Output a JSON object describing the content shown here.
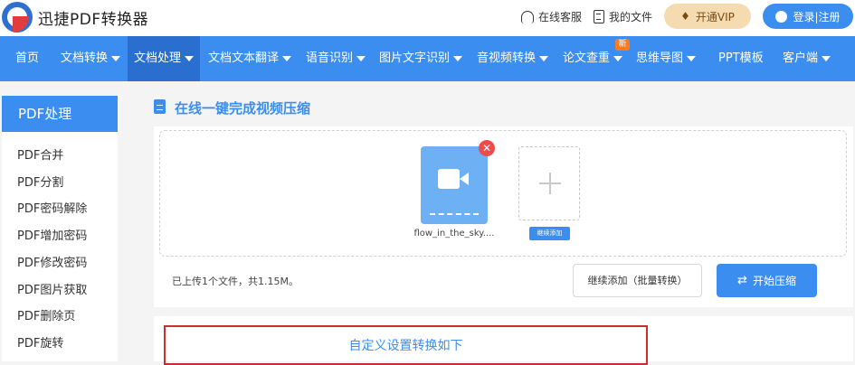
{
  "header": {
    "brand": "迅捷PDF转换器",
    "online_service": "在线客服",
    "my_files": "我的文件",
    "vip": "开通VIP",
    "login": "登录|注册"
  },
  "nav": {
    "items": [
      {
        "label": "首页",
        "has_caret": false
      },
      {
        "label": "文档转换",
        "has_caret": true
      },
      {
        "label": "文档处理",
        "has_caret": true,
        "active": true
      },
      {
        "label": "文档文本翻译",
        "has_caret": true
      },
      {
        "label": "语音识别",
        "has_caret": true
      },
      {
        "label": "图片文字识别",
        "has_caret": true
      },
      {
        "label": "音视频转换",
        "has_caret": true
      },
      {
        "label": "论文查重",
        "has_caret": true
      },
      {
        "label": "思维导图",
        "has_caret": true
      },
      {
        "label": "PPT模板",
        "has_caret": false
      },
      {
        "label": "客户端",
        "has_caret": true
      }
    ],
    "new_badge": "新"
  },
  "sidebar": {
    "heading": "PDF处理",
    "items": [
      "PDF合并",
      "PDF分割",
      "PDF密码解除",
      "PDF增加密码",
      "PDF修改密码",
      "PDF图片获取",
      "PDF删除页",
      "PDF旋转"
    ]
  },
  "main": {
    "section_title": "在线一键完成视频压缩",
    "file": {
      "name": "flow_in_the_sky...."
    },
    "add_label": "继续添加",
    "upload_status": "已上传1个文件，共1.15M。",
    "continue_button": "继续添加（批量转换）",
    "start_button": "开始压缩",
    "settings_title": "自定义设置转换如下"
  },
  "colors": {
    "primary": "#3b8ef0",
    "nav_active": "#2a6fcf",
    "vip_bg": "#f5dcb0",
    "danger": "#f04b4b",
    "highlight_border": "#c7302e"
  }
}
